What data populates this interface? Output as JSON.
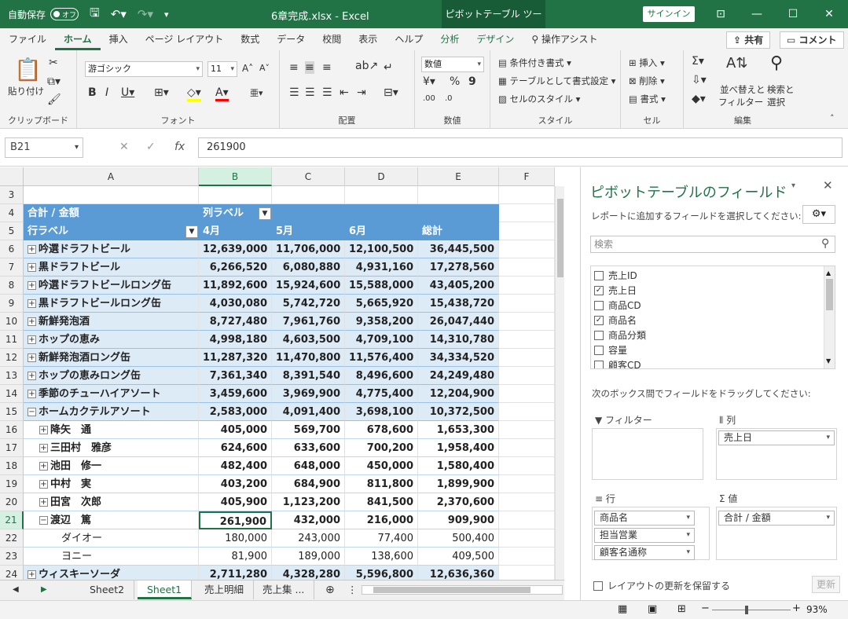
{
  "titlebar": {
    "autosave": "自動保存",
    "toggle": "オフ",
    "filename": "6章完成.xlsx  -  Excel",
    "context": "ピボットテーブル ツール",
    "signin": "サインイン"
  },
  "tabs": [
    "ファイル",
    "ホーム",
    "挿入",
    "ページ レイアウト",
    "数式",
    "データ",
    "校閲",
    "表示",
    "ヘルプ",
    "分析",
    "デザイン"
  ],
  "tell_me": "操作アシスト",
  "share": "共有",
  "comment": "コメント",
  "ribbon": {
    "clipboard": {
      "paste": "貼り付け",
      "label": "クリップボード"
    },
    "font": {
      "name": "游ゴシック",
      "size": "11",
      "label": "フォント"
    },
    "alignment": {
      "label": "配置"
    },
    "number": {
      "format": "数値",
      "label": "数値"
    },
    "styles": {
      "cond": "条件付き書式",
      "table": "テーブルとして書式設定",
      "cell": "セルのスタイル",
      "label": "スタイル"
    },
    "cells": {
      "insert": "挿入",
      "delete": "削除",
      "format": "書式",
      "label": "セル"
    },
    "editing": {
      "sort1": "並べ替えと",
      "sort2": "フィルター",
      "find1": "検索と",
      "find2": "選択",
      "label": "編集"
    }
  },
  "formula": {
    "namebox": "B21",
    "value": "261900"
  },
  "columns": [
    "A",
    "B",
    "C",
    "D",
    "E",
    "F"
  ],
  "rows": [
    {
      "n": "3",
      "cells": [
        "",
        "",
        "",
        "",
        ""
      ]
    },
    {
      "n": "4",
      "cells": [
        "合計 / 金額",
        "列ラベル",
        "",
        "",
        ""
      ]
    },
    {
      "n": "5",
      "cells": [
        "行ラベル",
        "4月",
        "5月",
        "6月",
        "総計"
      ]
    },
    {
      "n": "6",
      "cells": [
        "吟選ドラフトビール",
        "12,639,000",
        "11,706,000",
        "12,100,500",
        "36,445,500"
      ]
    },
    {
      "n": "7",
      "cells": [
        "黒ドラフトビール",
        "6,266,520",
        "6,080,880",
        "4,931,160",
        "17,278,560"
      ]
    },
    {
      "n": "8",
      "cells": [
        "吟選ドラフトビールロング缶",
        "11,892,600",
        "15,924,600",
        "15,588,000",
        "43,405,200"
      ]
    },
    {
      "n": "9",
      "cells": [
        "黒ドラフトビールロング缶",
        "4,030,080",
        "5,742,720",
        "5,665,920",
        "15,438,720"
      ]
    },
    {
      "n": "10",
      "cells": [
        "新鮮発泡酒",
        "8,727,480",
        "7,961,760",
        "9,358,200",
        "26,047,440"
      ]
    },
    {
      "n": "11",
      "cells": [
        "ホップの恵み",
        "4,998,180",
        "4,603,500",
        "4,709,100",
        "14,310,780"
      ]
    },
    {
      "n": "12",
      "cells": [
        "新鮮発泡酒ロング缶",
        "11,287,320",
        "11,470,800",
        "11,576,400",
        "34,334,520"
      ]
    },
    {
      "n": "13",
      "cells": [
        "ホップの恵みロング缶",
        "7,361,340",
        "8,391,540",
        "8,496,600",
        "24,249,480"
      ]
    },
    {
      "n": "14",
      "cells": [
        "季節のチューハイアソート",
        "3,459,600",
        "3,969,900",
        "4,775,400",
        "12,204,900"
      ]
    },
    {
      "n": "15",
      "cells": [
        "ホームカクテルアソート",
        "2,583,000",
        "4,091,400",
        "3,698,100",
        "10,372,500"
      ]
    },
    {
      "n": "16",
      "cells": [
        "降矢　通",
        "405,000",
        "569,700",
        "678,600",
        "1,653,300"
      ]
    },
    {
      "n": "17",
      "cells": [
        "三田村　雅彦",
        "624,600",
        "633,600",
        "700,200",
        "1,958,400"
      ]
    },
    {
      "n": "18",
      "cells": [
        "池田　修一",
        "482,400",
        "648,000",
        "450,000",
        "1,580,400"
      ]
    },
    {
      "n": "19",
      "cells": [
        "中村　実",
        "403,200",
        "684,900",
        "811,800",
        "1,899,900"
      ]
    },
    {
      "n": "20",
      "cells": [
        "田宮　次郎",
        "405,900",
        "1,123,200",
        "841,500",
        "2,370,600"
      ]
    },
    {
      "n": "21",
      "cells": [
        "渡辺　篤",
        "261,900",
        "432,000",
        "216,000",
        "909,900"
      ]
    },
    {
      "n": "22",
      "cells": [
        "ダイオー",
        "180,000",
        "243,000",
        "77,400",
        "500,400"
      ]
    },
    {
      "n": "23",
      "cells": [
        "ヨニー",
        "81,900",
        "189,000",
        "138,600",
        "409,500"
      ]
    },
    {
      "n": "24",
      "cells": [
        "ウィスキーソーダ",
        "2,711,280",
        "4,328,280",
        "5,596,800",
        "12,636,360"
      ]
    }
  ],
  "sheets": [
    "Sheet2",
    "Sheet1",
    "売上明細",
    "売上集 ..."
  ],
  "zoom": "93%",
  "pivot": {
    "title": "ピボットテーブルのフィールド",
    "subtitle": "レポートに追加するフィールドを選択してください:",
    "search": "検索",
    "fields": [
      {
        "name": "売上ID",
        "checked": false
      },
      {
        "name": "売上日",
        "checked": true
      },
      {
        "name": "商品CD",
        "checked": false
      },
      {
        "name": "商品名",
        "checked": true
      },
      {
        "name": "商品分類",
        "checked": false
      },
      {
        "name": "容量",
        "checked": false
      },
      {
        "name": "顧客CD",
        "checked": false
      }
    ],
    "drag_hint": "次のボックス間でフィールドをドラッグしてください:",
    "filter_label": "フィルター",
    "columns_label": "列",
    "rows_label": "行",
    "values_label": "値",
    "columns_items": [
      "売上日"
    ],
    "rows_items": [
      "商品名",
      "担当営業",
      "顧客名通称"
    ],
    "values_items": [
      "合計 / 金額"
    ],
    "defer": "レイアウトの更新を保留する",
    "update": "更新"
  }
}
